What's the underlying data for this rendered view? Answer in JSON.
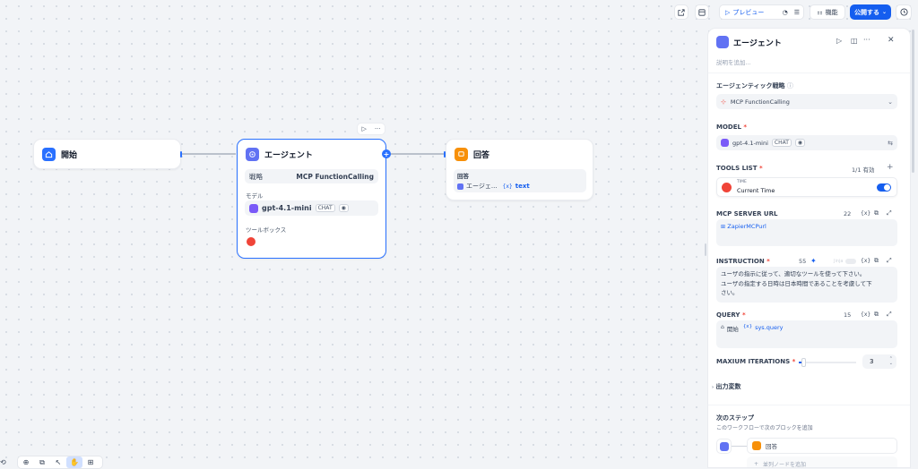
{
  "toolbar": {
    "preview_label": "プレビュー",
    "features_label": "機能",
    "publish_label": "公開する"
  },
  "nodes": {
    "start": {
      "title": "開始"
    },
    "agent": {
      "title": "エージェント",
      "strategy_label": "戦略",
      "strategy_value": "MCP FunctionCalling",
      "model_label": "モデル",
      "model_name": "gpt-4.1-mini",
      "model_tag": "CHAT",
      "toolbox_label": "ツールボックス"
    },
    "answer": {
      "title": "回答",
      "field_label": "回答",
      "ref_node": "エージェ...",
      "ref_var": "text",
      "ref_var_prefix": "{x}"
    }
  },
  "panel": {
    "title": "エージェント",
    "description_placeholder": "説明を追加...",
    "strategy_section": "エージェンティック戦略",
    "strategy_value": "MCP FunctionCalling",
    "model_section": "MODEL",
    "model_name": "gpt-4.1-mini",
    "model_tag": "CHAT",
    "tools_section": "TOOLS LIST",
    "tools_count": "1/1 有効",
    "tool_provider": "TIME",
    "tool_name": "Current Time",
    "mcp_section": "MCP SERVER URL",
    "mcp_count": "22",
    "mcp_value": "ZapierMCPurl",
    "instruction_section": "INSTRUCTION",
    "instruction_count": "55",
    "jinja_label": "Jinja",
    "instruction_line1": "ユーザの指示に従って、適切なツールを使って下さい。",
    "instruction_line2": "ユーザの指定する日時は日本時間であることを考慮して下",
    "instruction_line3": "さい。",
    "query_section": "QUERY",
    "query_count": "15",
    "query_node": "開始",
    "query_var": "sys.query",
    "iterations_section": "MAXIUM ITERATIONS",
    "iterations_value": "3",
    "output_vars": "出力変数",
    "next_step_title": "次のステップ",
    "next_step_desc": "このワークフローで次のブロックを追加",
    "next_node": "回答",
    "add_parallel": "並列ノードを追加",
    "var_symbol": "{x}"
  },
  "colors": {
    "accent": "#155eef",
    "agent_icon": "#6172f3",
    "answer_icon": "#f79009",
    "time_icon": "#f04438",
    "model_icon": "#7a5af8"
  }
}
